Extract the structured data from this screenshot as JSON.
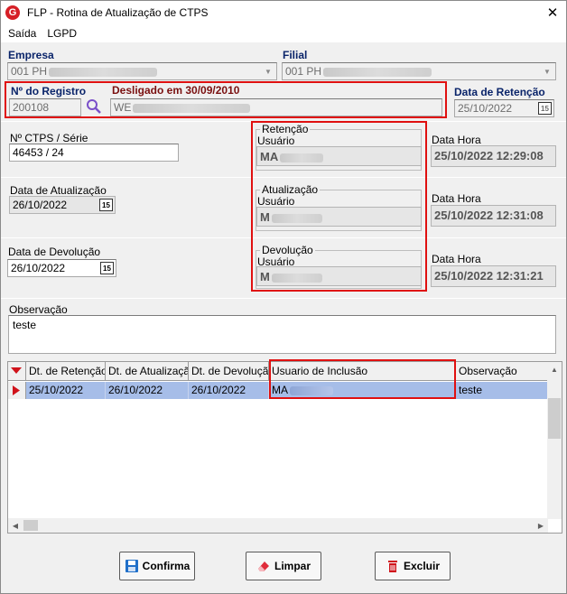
{
  "window": {
    "app_logo": "G",
    "title": "FLP - Rotina de Atualização de CTPS",
    "close_glyph": "✕"
  },
  "menu": {
    "items": [
      "Saída",
      "LGPD"
    ]
  },
  "empresa": {
    "label": "Empresa",
    "value": "001 PH"
  },
  "filial": {
    "label": "Filial",
    "value": "001 PH"
  },
  "registro": {
    "label": "Nº do Registro",
    "value": "200108",
    "desligado_label": "Desligado em 30/09/2010",
    "nome_value": "WE"
  },
  "retencao_data": {
    "label": "Data de Retenção",
    "value": "25/10/2022"
  },
  "ctps": {
    "label": "Nº CTPS / Série",
    "value": "46453 / 24"
  },
  "atualizacao_data": {
    "label": "Data de Atualização",
    "value": "26/10/2022"
  },
  "devolucao_data": {
    "label": "Data de Devolução",
    "value": "26/10/2022"
  },
  "calendar_glyph": "15",
  "groups": {
    "retencao": {
      "title": "Retenção",
      "user_label": "Usuário",
      "user_value": "MA",
      "dh_label": "Data Hora",
      "dh_value": "25/10/2022 12:29:08"
    },
    "atualizacao": {
      "title": "Atualização",
      "user_label": "Usuário",
      "user_value": "M",
      "dh_label": "Data Hora",
      "dh_value": "25/10/2022 12:31:08"
    },
    "devolucao": {
      "title": "Devolução",
      "user_label": "Usuário",
      "user_value": "M",
      "dh_label": "Data Hora",
      "dh_value": "25/10/2022 12:31:21"
    }
  },
  "observacao": {
    "label": "Observação",
    "value": "teste"
  },
  "grid": {
    "columns": [
      "Dt. de Retenção",
      "Dt. de Atualização",
      "Dt. de Devolução",
      "Usuario de Inclusão",
      "Observação"
    ],
    "rows": [
      {
        "dt_retencao": "25/10/2022",
        "dt_atualizacao": "26/10/2022",
        "dt_devolucao": "26/10/2022",
        "usuario": "MA",
        "observacao": "teste"
      }
    ]
  },
  "buttons": {
    "confirma": "Confirma",
    "limpar": "Limpar",
    "excluir": "Excluir"
  },
  "colors": {
    "highlight_red": "#e01010",
    "selected_row": "#a6bde8",
    "label_blue": "#0a246a"
  }
}
